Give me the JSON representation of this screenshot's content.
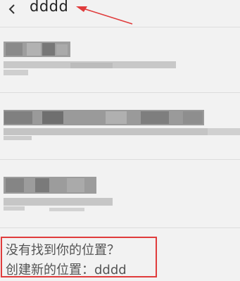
{
  "header": {
    "back_icon": "chevron-left-icon",
    "search_query": "dddd",
    "annotation_color": "#e03c3c"
  },
  "results": [
    {
      "name": "",
      "address": "",
      "blurred": true
    },
    {
      "name": "",
      "address": "",
      "blurred": true
    },
    {
      "name": "",
      "address": "",
      "blurred": true
    }
  ],
  "create_prompt": {
    "not_found_text": "没有找到你的位置？",
    "create_text": "创建新的位置：dddd",
    "highlight_color": "#e03c3c"
  }
}
